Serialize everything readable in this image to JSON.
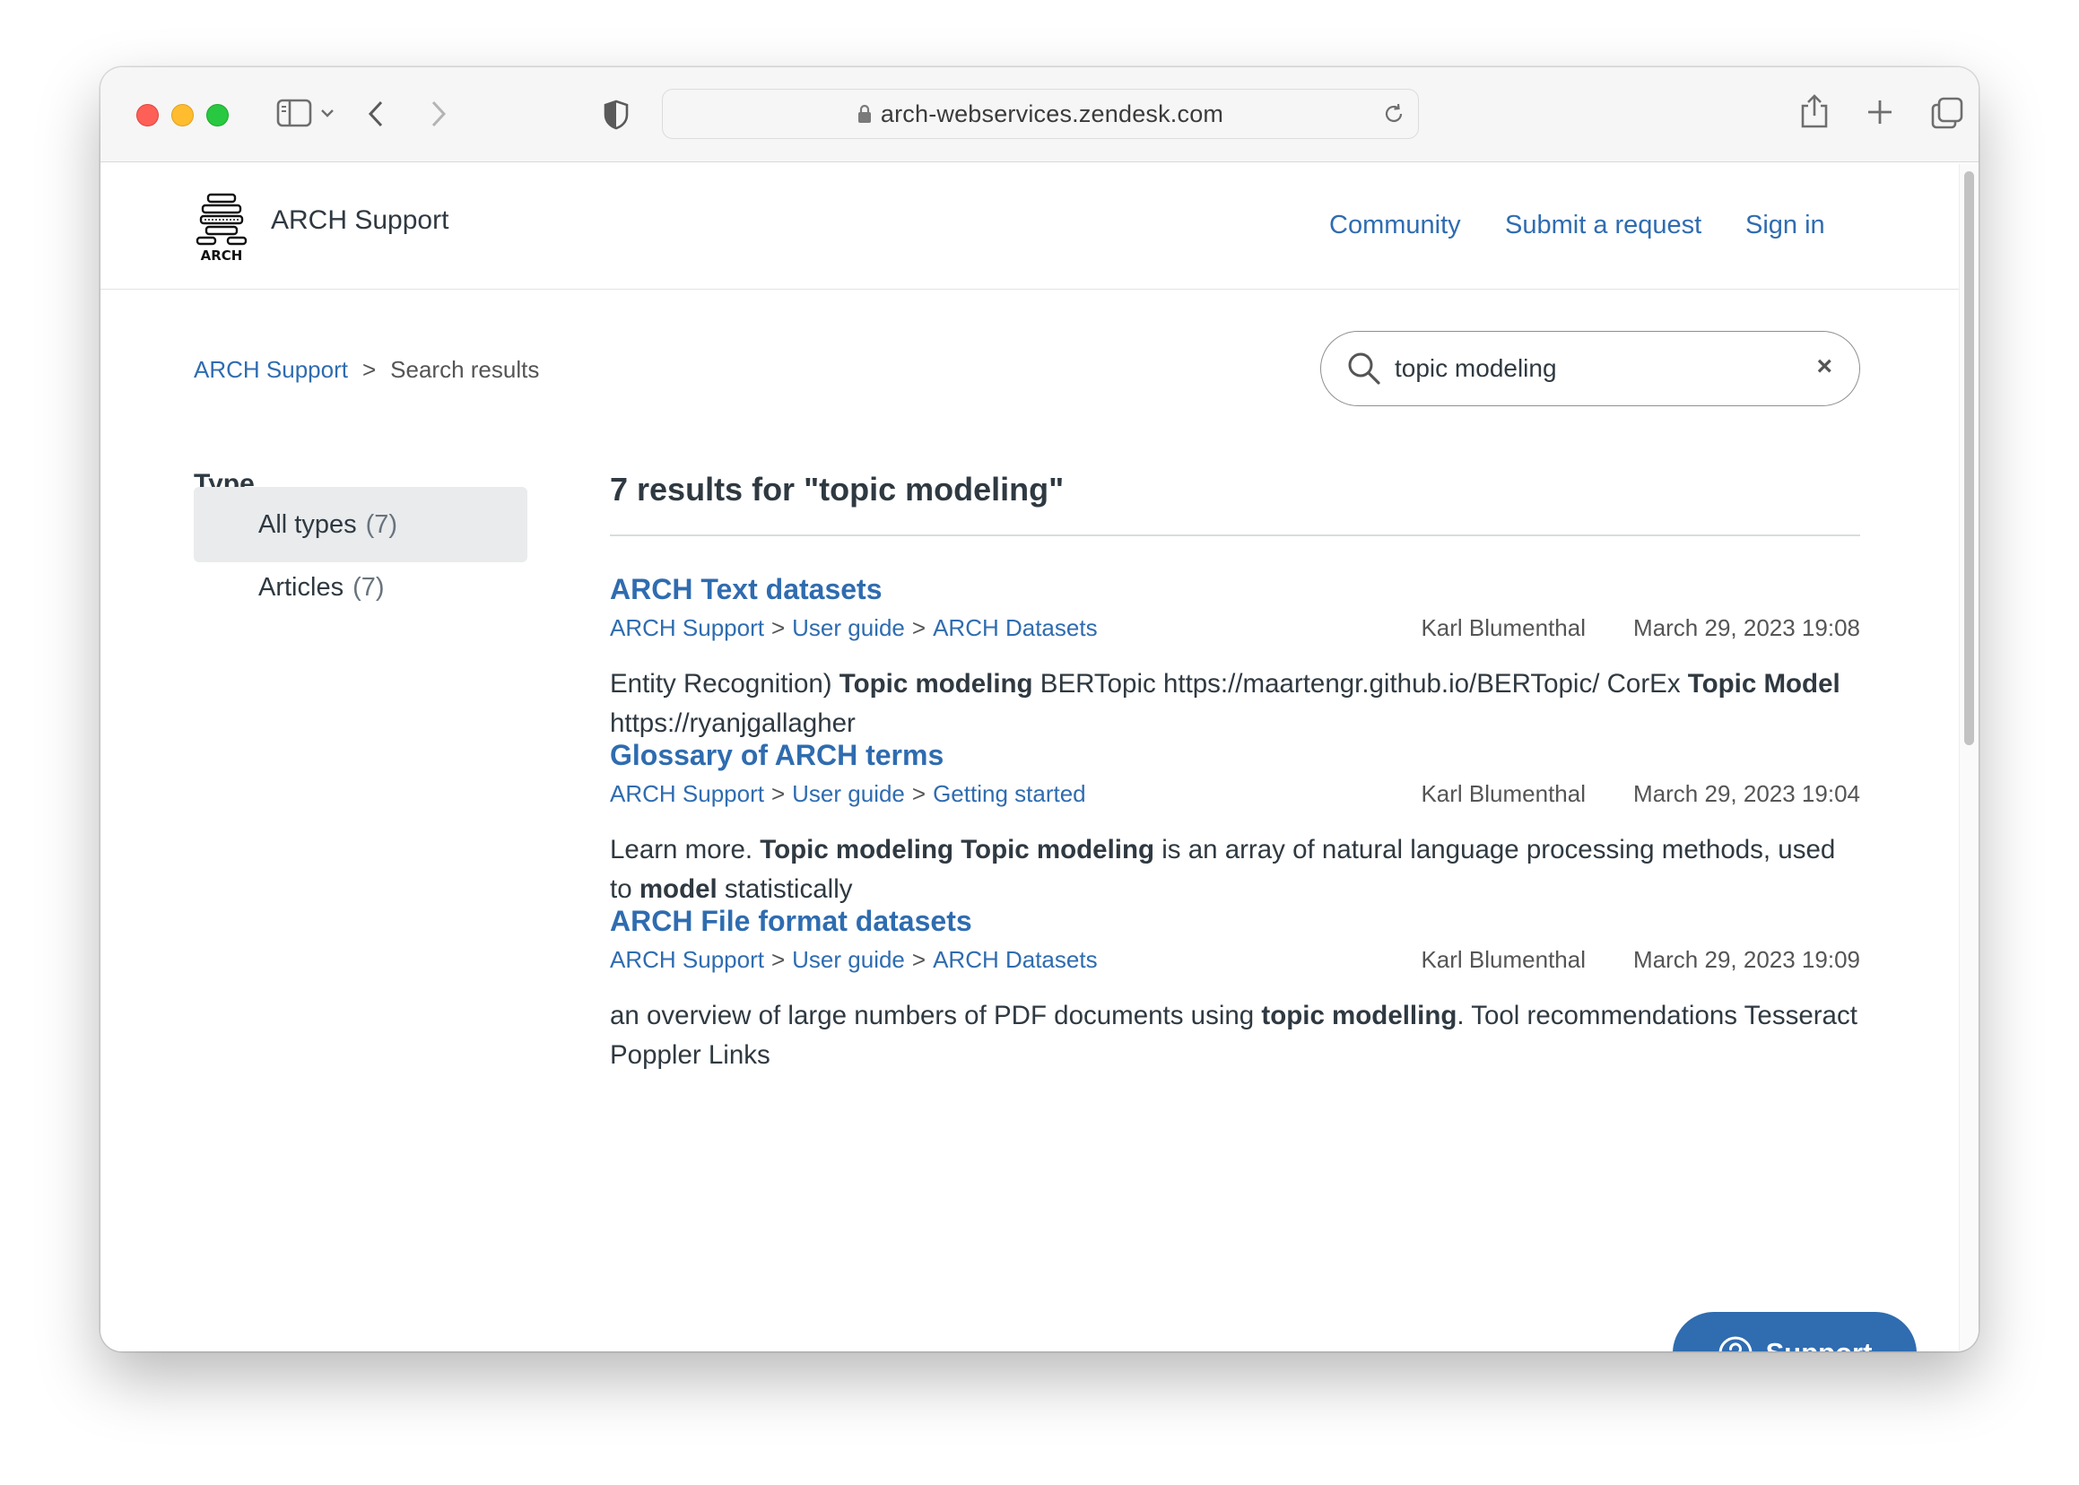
{
  "browser": {
    "url": "arch-webservices.zendesk.com"
  },
  "header": {
    "logo_text": "ARCH",
    "site_name": "ARCH Support",
    "nav": {
      "community": "Community",
      "submit_request": "Submit a request",
      "sign_in": "Sign in"
    }
  },
  "breadcrumb": {
    "home": "ARCH Support",
    "separator": ">",
    "current": "Search results"
  },
  "search": {
    "value": "topic modeling",
    "clear": "×"
  },
  "sidebar": {
    "heading": "Type",
    "filters": [
      {
        "label": "All types",
        "count": "(7)",
        "active": true
      },
      {
        "label": "Articles",
        "count": "(7)",
        "active": false
      }
    ]
  },
  "results": {
    "heading": "7 results for \"topic modeling\"",
    "items": [
      {
        "title": "ARCH Text datasets",
        "path": [
          "ARCH Support",
          "User guide",
          "ARCH Datasets"
        ],
        "author": "Karl Blumenthal",
        "date": "March 29, 2023 19:08",
        "snippet": [
          {
            "t": "Entity Recognition) ",
            "b": false
          },
          {
            "t": "Topic modeling",
            "b": true
          },
          {
            "t": " BERTopic https://maartengr.github.io/BERTopic/ CorEx ",
            "b": false
          },
          {
            "t": "Topic Model",
            "b": true
          },
          {
            "t": " https://ryanjgallagher",
            "b": false
          }
        ]
      },
      {
        "title": "Glossary of ARCH terms",
        "path": [
          "ARCH Support",
          "User guide",
          "Getting started"
        ],
        "author": "Karl Blumenthal",
        "date": "March 29, 2023 19:04",
        "snippet": [
          {
            "t": "Learn more. ",
            "b": false
          },
          {
            "t": "Topic modeling Topic modeling",
            "b": true
          },
          {
            "t": " is an array of natural language processing methods, used to ",
            "b": false
          },
          {
            "t": "model",
            "b": true
          },
          {
            "t": " statistically",
            "b": false
          }
        ]
      },
      {
        "title": "ARCH File format datasets",
        "path": [
          "ARCH Support",
          "User guide",
          "ARCH Datasets"
        ],
        "author": "Karl Blumenthal",
        "date": "March 29, 2023 19:09",
        "snippet": [
          {
            "t": "an overview of large numbers of PDF documents using ",
            "b": false
          },
          {
            "t": "topic modelling",
            "b": true
          },
          {
            "t": ". Tool recommendations Tesseract Poppler Links",
            "b": false
          }
        ]
      }
    ]
  },
  "support_button": {
    "label": "Support"
  },
  "colors": {
    "link": "#2f6cb0",
    "text": "#2f3941",
    "active_filter_bg": "#e9ebed",
    "support_bg": "#2f6cb0"
  }
}
